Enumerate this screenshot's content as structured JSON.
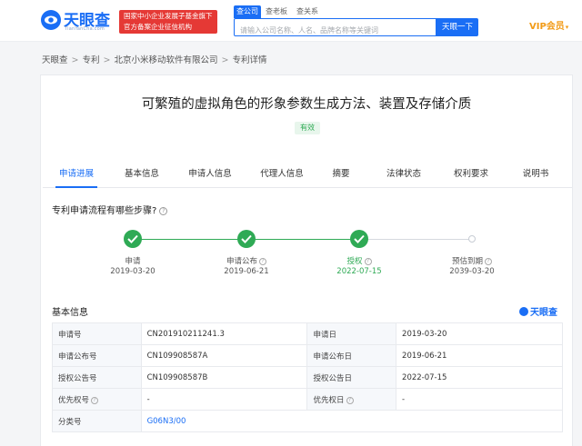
{
  "header": {
    "logo_text": "天眼查",
    "logo_sub": "TianYanCha.com",
    "promo_line1": "国家中小企业发展子基金旗下",
    "promo_line2": "官方备案企业征信机构",
    "search_tabs": [
      "查公司",
      "查老板",
      "查关系"
    ],
    "search_placeholder": "请输入公司名称、人名、品牌名称等关键词",
    "search_button": "天眼一下",
    "vip_label": "VIP会员",
    "vip_arrow": "▾"
  },
  "breadcrumb": [
    "天眼查",
    "专利",
    "北京小米移动软件有限公司",
    "专利详情"
  ],
  "breadcrumb_sep": ">",
  "patent": {
    "title": "可繁殖的虚拟角色的形象参数生成方法、装置及存储介质",
    "status": "有效"
  },
  "tabs": [
    "申请进展",
    "基本信息",
    "申请人信息",
    "代理人信息",
    "摘要",
    "法律状态",
    "权利要求",
    "说明书"
  ],
  "progress": {
    "question": "专利申请流程有哪些步骤?",
    "help_glyph": "?",
    "steps": [
      {
        "label": "申请",
        "date": "2019-03-20",
        "state": "done",
        "help": false
      },
      {
        "label": "申请公布",
        "date": "2019-06-21",
        "state": "done",
        "help": true
      },
      {
        "label": "授权",
        "date": "2022-07-15",
        "state": "current",
        "help": true
      },
      {
        "label": "预估到期",
        "date": "2039-03-20",
        "state": "pending",
        "help": true
      }
    ]
  },
  "basic_info": {
    "title": "基本信息",
    "brand": "天眼查",
    "rows": [
      [
        {
          "k": "申请号",
          "v": "CN201910211241.3",
          "help": false
        },
        {
          "k": "申请日",
          "v": "2019-03-20",
          "help": false
        }
      ],
      [
        {
          "k": "申请公布号",
          "v": "CN109908587A",
          "help": false
        },
        {
          "k": "申请公布日",
          "v": "2019-06-21",
          "help": false
        }
      ],
      [
        {
          "k": "授权公告号",
          "v": "CN109908587B",
          "help": false
        },
        {
          "k": "授权公告日",
          "v": "2022-07-15",
          "help": false
        }
      ],
      [
        {
          "k": "优先权号",
          "v": "-",
          "help": true
        },
        {
          "k": "优先权日",
          "v": "-",
          "help": true
        }
      ],
      [
        {
          "k": "分类号",
          "v": "G06N3/00",
          "help": false,
          "link": true
        }
      ]
    ]
  },
  "colors": {
    "brand_blue": "#1a6ef5",
    "status_green": "#2faa55",
    "promo_red": "#e53935",
    "vip_orange": "#f29b16"
  }
}
